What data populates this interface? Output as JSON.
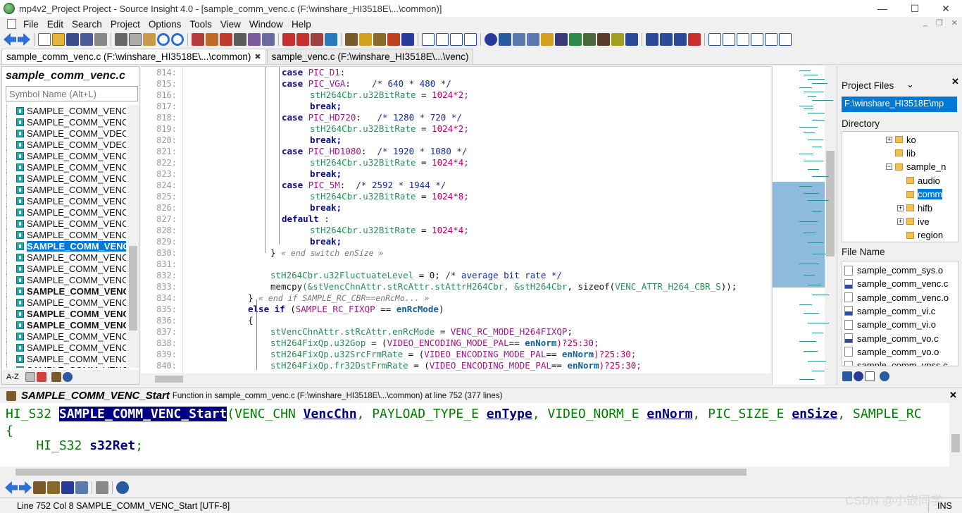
{
  "window": {
    "title": "mp4v2_Project Project - Source Insight 4.0 - [sample_comm_venc.c (F:\\winshare_HI3518E\\...\\common)]",
    "min_glyph": "—",
    "max_glyph": "☐",
    "close_glyph": "✕"
  },
  "menu": [
    "File",
    "Edit",
    "Search",
    "Project",
    "Options",
    "Tools",
    "View",
    "Window",
    "Help"
  ],
  "tabs": [
    {
      "label": "sample_comm_venc.c (F:\\winshare_HI3518E\\...\\common)",
      "close": "✖"
    },
    {
      "label": "sample_venc.c (F:\\winshare_HI3518E\\...\\venc)"
    }
  ],
  "symbol_panel": {
    "title": "sample_comm_venc.c",
    "search_placeholder": "Symbol Name (Alt+L)",
    "items": [
      "SAMPLE_COMM_VENC_",
      "SAMPLE_COMM_VENC_",
      "SAMPLE_COMM_VDEC_",
      "SAMPLE_COMM_VDEC_",
      "SAMPLE_COMM_VENC_",
      "SAMPLE_COMM_VENC_",
      "SAMPLE_COMM_VENC_",
      "SAMPLE_COMM_VENC_",
      "SAMPLE_COMM_VENC_",
      "SAMPLE_COMM_VENC_",
      "SAMPLE_COMM_VENC_",
      "SAMPLE_COMM_VENC_",
      "SAMPLE_COMM_VENC",
      "SAMPLE_COMM_VENC_",
      "SAMPLE_COMM_VENC_",
      "SAMPLE_COMM_VENC_",
      "SAMPLE_COMM_VENC",
      "SAMPLE_COMM_VENC_",
      "SAMPLE_COMM_VENC",
      "SAMPLE_COMM_VENC",
      "SAMPLE_COMM_VENC_",
      "SAMPLE_COMM_VENC_",
      "SAMPLE_COMM_VENC_",
      "SAMPLE_COMM_VENC_"
    ],
    "selected_index": 12,
    "bold_indices": [
      16,
      18,
      19
    ],
    "sort_label": "A-Z"
  },
  "editor": {
    "line_numbers": [
      "814:",
      "815:",
      "816:",
      "817:",
      "818:",
      "819:",
      "820:",
      "821:",
      "822:",
      "823:",
      "824:",
      "825:",
      "826:",
      "827:",
      "828:",
      "829:",
      "830:",
      "831:",
      "832:",
      "833:",
      "834:",
      "835:",
      "836:",
      "837:",
      "838:",
      "839:",
      "840:"
    ],
    "code": {
      "case": "case",
      "break": "break;",
      "default": "default",
      "colon": " :",
      "tok_d1": "PIC_D1",
      "tok_vga": "PIC_VGA",
      "tok_hd720": "PIC_HD720",
      "tok_hd1080": "PIC_HD1080",
      "tok_5m": "PIC_5M",
      "d1_colon": ":",
      "vga_colon": ":    ",
      "cmt_vga": "/* 640 * 480 */",
      "hd720_colon": ":   ",
      "cmt_hd720": "/* 1280 * 720 */",
      "hd1080_colon": ":  ",
      "cmt_hd1080": "/* 1920 * 1080 */",
      "m5_colon": ":  ",
      "cmt_5m": "/* 2592 * 1944 */",
      "bitrate_lhs": "stH264Cbr.u32BitRate",
      "eq": " = ",
      "mul2": "1024*2;",
      "mul4": "1024*4;",
      "mul8": "1024*8;",
      "brace_close": "}",
      "end_switch": "« end switch enSize »",
      "fluct_lhs": "stH264Cbr.u32FluctuateLevel",
      "fluct_rhs": " = 0; ",
      "cmt_avg": "/* average bit rate */",
      "memcpy_fn": "memcpy",
      "memcpy_a": "(&stVencChnAttr.stRcAttr.stAttrH264Cbr",
      "memcpy_b": ", &stH264Cbr",
      "memcpy_c": ", sizeof(",
      "memcpy_d": "VENC_ATTR_H264_CBR_S",
      "memcpy_e": "));",
      "end_if": "« end if SAMPLE_RC_CBR==enRcMo... »",
      "else_if": "else if",
      "paren_open": " (",
      "rc_fixqp": "SAMPLE_RC_FIXQP",
      "eqeq": " == ",
      "enrcmode": "enRcMode",
      "paren_close": ")",
      "brace_open": "{",
      "rcmode_lhs": "stVencChnAttr.stRcAttr.enRcMode",
      "rcmode_rhs": "VENC_RC_MODE_H264FIXQP",
      "semi": ";",
      "gop_lhs": "stH264FixQp.u32Gop",
      "src_lhs": "stH264FixQp.u32SrcFrmRate",
      "dst_lhs": "stH264FixQp.fr32DstFrmRate",
      "pal": "VIDEO_ENCODING_MODE_PAL",
      "eqeq2": "== ",
      "ennorm": "enNorm",
      "tern": ")?25:30;",
      "open_paren": "("
    }
  },
  "project_panel": {
    "project_files_label": "Project Files",
    "path_value": "F:\\winshare_HI3518E\\mp",
    "directory_label": "Directory",
    "dirs": [
      {
        "name": "ko",
        "expand": "+"
      },
      {
        "name": "lib",
        "expand": ""
      },
      {
        "name": "sample_n",
        "expand": "−"
      },
      {
        "name": "audio",
        "expand": ""
      },
      {
        "name": "comm",
        "expand": "",
        "selected": true
      },
      {
        "name": "hifb",
        "expand": "+"
      },
      {
        "name": "ive",
        "expand": "+"
      },
      {
        "name": "region",
        "expand": ""
      }
    ],
    "file_name_label": "File Name",
    "files": [
      {
        "name": "sample_comm_sys.o",
        "c": false
      },
      {
        "name": "sample_comm_venc.c",
        "c": true
      },
      {
        "name": "sample_comm_venc.o",
        "c": false
      },
      {
        "name": "sample_comm_vi.c",
        "c": true
      },
      {
        "name": "sample_comm_vi.o",
        "c": false
      },
      {
        "name": "sample_comm_vo.c",
        "c": true
      },
      {
        "name": "sample_comm_vo.o",
        "c": false
      },
      {
        "name": "sample_comm_vpss.c",
        "c": true
      }
    ]
  },
  "context": {
    "symbol": "SAMPLE_COMM_VENC_Start",
    "description": "Function in sample_comm_venc.c (F:\\winshare_HI3518E\\...\\common) at line 752 (377 lines)",
    "line1_type": "HI_S32 ",
    "line1_name": "SAMPLE_COMM_VENC_Start",
    "line1_open": "(",
    "p1_type": "VENC_CHN ",
    "p1_name": "VencChn",
    "comma": ", ",
    "p2_type": "PAYLOAD_TYPE_E ",
    "p2_name": "enType",
    "p3_type": "VIDEO_NORM_E ",
    "p3_name": "enNorm",
    "p4_type": "PIC_SIZE_E ",
    "p4_name": "enSize",
    "p5_type": "SAMPLE_RC",
    "line2": "{",
    "line3_type": "    HI_S32 ",
    "line3_name": "s32Ret",
    "line3_semi": ";"
  },
  "status": {
    "position": "Line 752  Col 8  SAMPLE_COMM_VENC_Start [UTF-8]",
    "mode": "INS"
  },
  "watermark": "CSDN @小嵌同学",
  "colors": {
    "selection": "#0078d7",
    "context_highlight": "#000080",
    "param_name": "#00007f",
    "type_green": "#008000"
  }
}
